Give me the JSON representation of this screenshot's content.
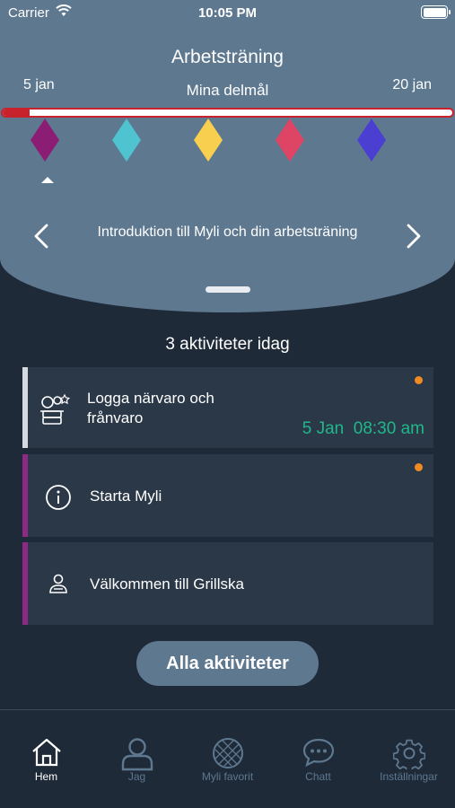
{
  "status_bar": {
    "carrier": "Carrier",
    "time": "10:05 PM"
  },
  "header": {
    "title": "Arbetsträning",
    "start_date": "5 jan",
    "end_date": "20 jan",
    "goals_label": "Mina delmål",
    "progress_fraction": 0.06,
    "progress_color": "#c8232c",
    "goal_colors": [
      "#8b1e74",
      "#4fc3d0",
      "#f8cf4f",
      "#de4565",
      "#4a3fd1"
    ],
    "selected_goal_index": 0,
    "current_goal_text": "Introduktion till Myli och din arbetsträning"
  },
  "activities": {
    "heading": "3 aktiviteter idag",
    "items": [
      {
        "title": "Logga närvaro och frånvaro",
        "date": "5 Jan",
        "time": "08:30 am",
        "stripe_color": "#d6d9dd",
        "has_dot": true,
        "icon": "attendance-icon"
      },
      {
        "title": "Starta Myli",
        "stripe_color": "#8e2a86",
        "has_dot": true,
        "icon": "info-icon"
      },
      {
        "title": "Välkommen till Grillska",
        "stripe_color": "#8e2a86",
        "has_dot": false,
        "icon": "person-icon"
      }
    ]
  },
  "all_activities_button": "Alla aktiviteter",
  "tabs": [
    {
      "label": "Hem",
      "icon": "home-icon",
      "active": true
    },
    {
      "label": "Jag",
      "icon": "user-icon",
      "active": false
    },
    {
      "label": "Myli favorit",
      "icon": "myli-logo-icon",
      "active": false
    },
    {
      "label": "Chatt",
      "icon": "chat-icon",
      "active": false
    },
    {
      "label": "Inställningar",
      "icon": "gear-icon",
      "active": false
    }
  ],
  "colors": {
    "accent_green": "#20b88a",
    "notification_dot": "#f08a24",
    "header_bg": "#5e7890",
    "page_bg": "#1f2a38"
  }
}
